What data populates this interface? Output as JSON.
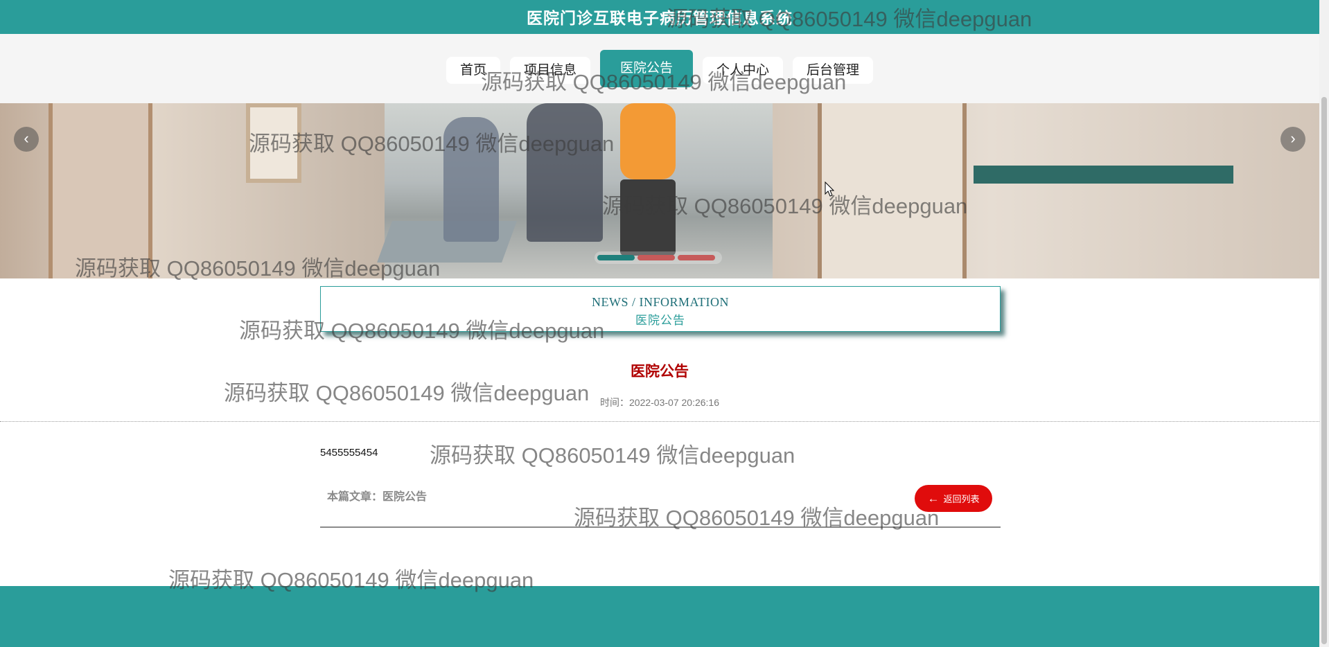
{
  "header": {
    "site_title": "医院门诊互联电子病历管理信息系统"
  },
  "nav": {
    "items": [
      {
        "label": "首页"
      },
      {
        "label": "项目信息"
      },
      {
        "label": "医院公告"
      },
      {
        "label": "个人中心"
      },
      {
        "label": "后台管理"
      }
    ],
    "active": "医院公告"
  },
  "carousel": {
    "prev_icon": "chevron-left-icon",
    "next_icon": "chevron-right-icon",
    "slide_count": 3,
    "active_slide": 1
  },
  "section": {
    "english_title": "NEWS / INFORMATION",
    "chinese_title": "医院公告"
  },
  "article": {
    "title": "医院公告",
    "time": "时间：2022-03-07 20:26:16",
    "body": "5455555454",
    "footer_label": "本篇文章：医院公告",
    "back_label": "返回列表"
  },
  "watermark": {
    "text": "源码获取 QQ86050149 微信deepguan"
  },
  "colors": {
    "primary": "#2a9d9a",
    "title_red": "#b00000",
    "back_button": "#e00c0c"
  }
}
